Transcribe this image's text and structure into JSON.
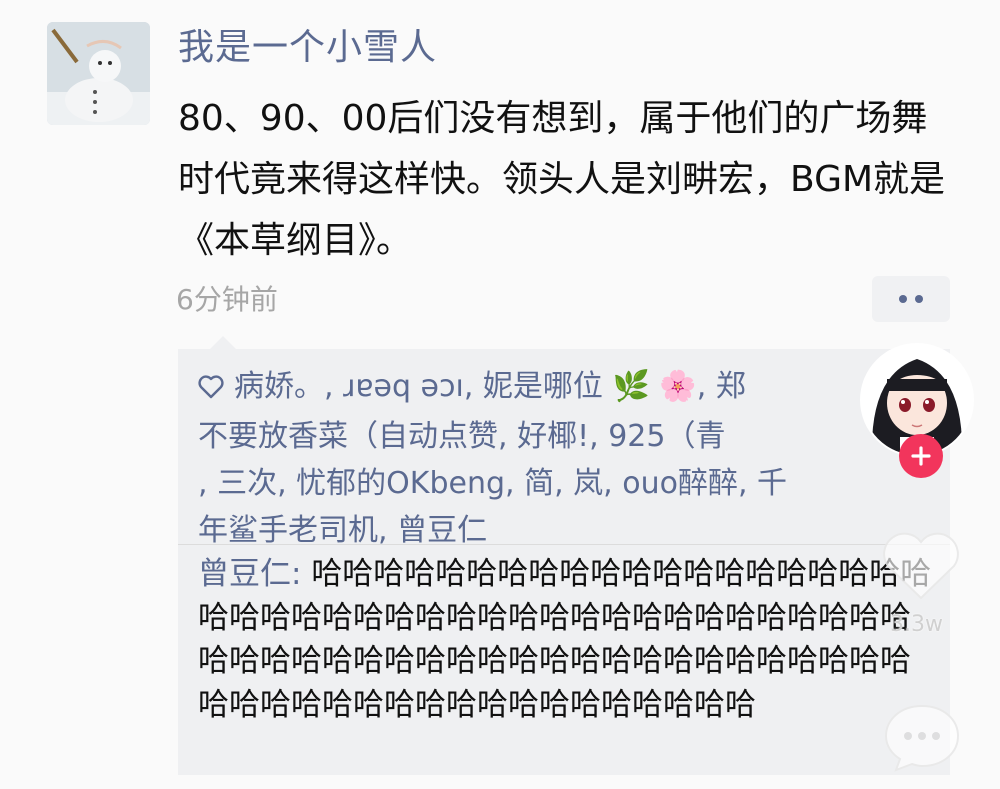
{
  "post": {
    "nickname": "我是一个小雪人",
    "text": "80、90、00后们没有想到，属于他们的广场舞时代竟来得这样快。领头人是刘畊宏，BGM就是《本草纲目》。",
    "timestamp": "6分钟前"
  },
  "likes": {
    "icon": "heart-icon",
    "names": [
      "病娇。",
      "ɹɐǝq ǝɔı",
      "妮是哪位",
      "郑",
      "不要放香菜（自动点赞, 好椰!",
      "925（青",
      "三次",
      "忧郁的OKbeng",
      "简",
      "岚",
      "ouo醉醉",
      "千",
      "年鲨手老司机",
      "曾豆仁"
    ],
    "emoji_leaf": "🌿",
    "emoji_flower": "🌸"
  },
  "comment": {
    "author": "曾豆仁",
    "separator": ": ",
    "text": "哈哈哈哈哈哈哈哈哈哈哈哈哈哈哈哈哈哈哈哈哈哈哈哈哈哈哈哈哈哈哈哈哈哈哈哈哈哈哈哈哈哈哈哈哈哈哈哈哈哈哈哈哈哈哈哈哈哈哈哈哈哈哈哈哈哈哈哈哈哈哈哈哈哈哈哈哈哈哈哈哈哈哈哈"
  },
  "overlay": {
    "like_count": "3.3w"
  },
  "colors": {
    "link": "#5b6a91",
    "follow": "#f2355c"
  }
}
